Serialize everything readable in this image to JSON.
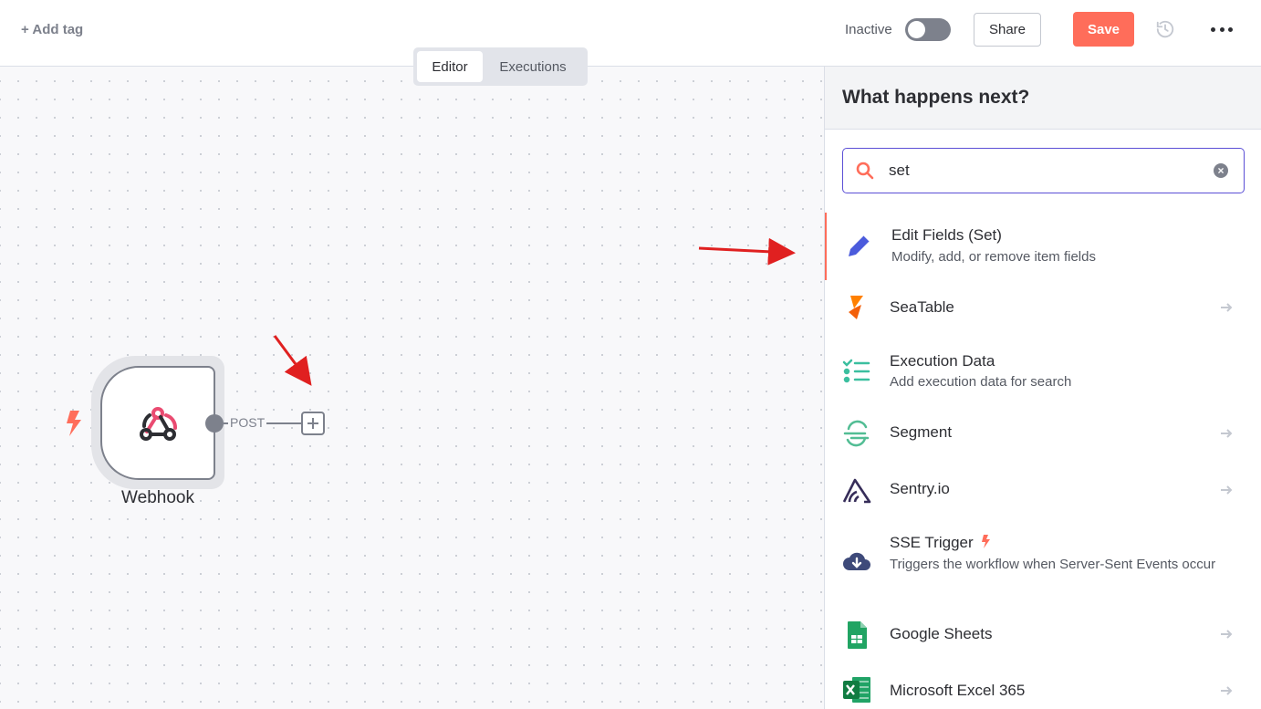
{
  "topbar": {
    "add_tag": "+ Add tag",
    "inactive_label": "Inactive",
    "active": false,
    "share_label": "Share",
    "save_label": "Save"
  },
  "tabs": [
    {
      "label": "Editor",
      "selected": true
    },
    {
      "label": "Executions",
      "selected": false
    }
  ],
  "canvas": {
    "node": {
      "label": "Webhook",
      "icon": "webhook-icon"
    },
    "connection_label": "POST"
  },
  "panel": {
    "title": "What happens next?",
    "search": {
      "value": "set",
      "placeholder": "Search nodes..."
    },
    "items": [
      {
        "title": "Edit Fields (Set)",
        "desc": "Modify, add, or remove item fields",
        "icon": "pencil-icon"
      },
      {
        "title": "SeaTable",
        "desc": "",
        "icon": "seatable-icon"
      },
      {
        "title": "Execution Data",
        "desc": "Add execution data for search",
        "icon": "execution-data-icon"
      },
      {
        "title": "Segment",
        "desc": "",
        "icon": "segment-icon"
      },
      {
        "title": "Sentry.io",
        "desc": "",
        "icon": "sentry-icon"
      },
      {
        "title": "SSE Trigger",
        "desc": "Triggers the workflow when Server-Sent Events occur",
        "icon": "cloud-download-icon"
      },
      {
        "title": "Google Sheets",
        "desc": "",
        "icon": "google-sheets-icon"
      },
      {
        "title": "Microsoft Excel 365",
        "desc": "",
        "icon": "excel-icon"
      }
    ]
  },
  "colors": {
    "accent": "#ff6d5a",
    "focus": "#5b4fd6"
  }
}
